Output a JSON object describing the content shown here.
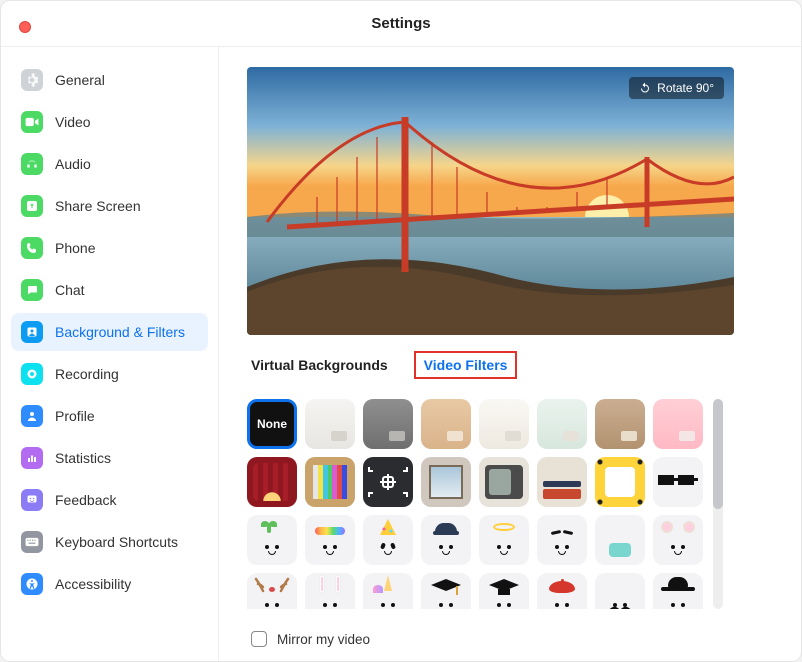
{
  "window": {
    "title": "Settings"
  },
  "sidebar": {
    "items": [
      {
        "label": "General",
        "color": "#cfd2d7",
        "icon": "gear"
      },
      {
        "label": "Video",
        "color": "#4cd964",
        "icon": "video"
      },
      {
        "label": "Audio",
        "color": "#4cd964",
        "icon": "audio"
      },
      {
        "label": "Share Screen",
        "color": "#4cd964",
        "icon": "share"
      },
      {
        "label": "Phone",
        "color": "#4cd964",
        "icon": "phone"
      },
      {
        "label": "Chat",
        "color": "#4cd964",
        "icon": "chat"
      },
      {
        "label": "Background & Filters",
        "color": "#0e9bf2",
        "icon": "bgfilters",
        "active": true
      },
      {
        "label": "Recording",
        "color": "#0de1f0",
        "icon": "record"
      },
      {
        "label": "Profile",
        "color": "#2f8cff",
        "icon": "profile"
      },
      {
        "label": "Statistics",
        "color": "#b36bf2",
        "icon": "stats"
      },
      {
        "label": "Feedback",
        "color": "#8b7bf5",
        "icon": "feedback"
      },
      {
        "label": "Keyboard Shortcuts",
        "color": "#9296a1",
        "icon": "keyboard"
      },
      {
        "label": "Accessibility",
        "color": "#2f8cff",
        "icon": "accessibility"
      }
    ]
  },
  "preview": {
    "rotate_label": "Rotate 90°"
  },
  "tabs": {
    "virtual_backgrounds": "Virtual Backgrounds",
    "video_filters": "Video Filters",
    "active": "video_filters"
  },
  "filters": {
    "none_label": "None",
    "items": [
      {
        "id": "none",
        "label": "None",
        "selected": true
      },
      {
        "id": "room-light"
      },
      {
        "id": "room-gray"
      },
      {
        "id": "room-tan"
      },
      {
        "id": "room-white"
      },
      {
        "id": "room-mint"
      },
      {
        "id": "room-brown"
      },
      {
        "id": "room-pink"
      },
      {
        "id": "theater"
      },
      {
        "id": "retro-tv-bars"
      },
      {
        "id": "camera-frame"
      },
      {
        "id": "window-frame"
      },
      {
        "id": "crt-tv"
      },
      {
        "id": "news-frame"
      },
      {
        "id": "emoji-frame"
      },
      {
        "id": "pixel-glasses"
      },
      {
        "id": "sprout"
      },
      {
        "id": "rainbow"
      },
      {
        "id": "party-hat"
      },
      {
        "id": "cap"
      },
      {
        "id": "halo"
      },
      {
        "id": "eyebrows"
      },
      {
        "id": "face-mask"
      },
      {
        "id": "bear-ears"
      },
      {
        "id": "antlers"
      },
      {
        "id": "bunny-ears"
      },
      {
        "id": "unicorn"
      },
      {
        "id": "grad-cap"
      },
      {
        "id": "grad-cap-2"
      },
      {
        "id": "beret"
      },
      {
        "id": "mustache"
      },
      {
        "id": "black-hat"
      }
    ]
  },
  "footer": {
    "mirror_label": "Mirror my video",
    "mirror_checked": false
  }
}
